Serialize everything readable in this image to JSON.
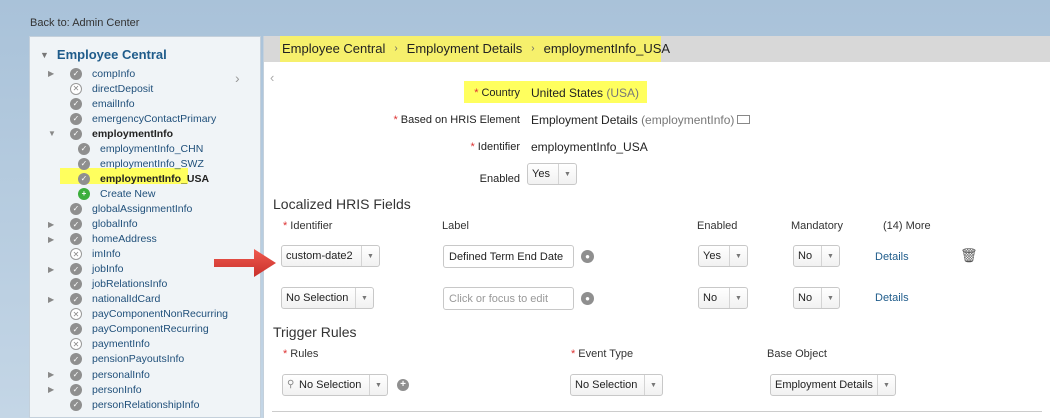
{
  "back_link": "Back to: Admin Center",
  "tree": {
    "root": "Employee Central",
    "items": [
      {
        "label": "compInfo",
        "icon": "check",
        "exp": true
      },
      {
        "label": "directDeposit",
        "icon": "x",
        "exp": false
      },
      {
        "label": "emailInfo",
        "icon": "check",
        "exp": false
      },
      {
        "label": "emergencyContactPrimary",
        "icon": "check",
        "exp": false
      },
      {
        "label": "employmentInfo",
        "icon": "check",
        "exp": "open"
      },
      {
        "label": "employmentInfo_CHN",
        "icon": "check",
        "exp": false
      },
      {
        "label": "employmentInfo_SWZ",
        "icon": "check",
        "exp": false
      },
      {
        "label": "employmentInfo_USA",
        "icon": "check",
        "exp": false
      },
      {
        "label": "Create New",
        "icon": "plus",
        "exp": false
      },
      {
        "label": "globalAssignmentInfo",
        "icon": "check",
        "exp": false
      },
      {
        "label": "globalInfo",
        "icon": "check",
        "exp": true
      },
      {
        "label": "homeAddress",
        "icon": "check",
        "exp": true
      },
      {
        "label": "imInfo",
        "icon": "x",
        "exp": false
      },
      {
        "label": "jobInfo",
        "icon": "check",
        "exp": true
      },
      {
        "label": "jobRelationsInfo",
        "icon": "check",
        "exp": false
      },
      {
        "label": "nationalIdCard",
        "icon": "check",
        "exp": true
      },
      {
        "label": "payComponentNonRecurring",
        "icon": "x",
        "exp": false
      },
      {
        "label": "payComponentRecurring",
        "icon": "check",
        "exp": false
      },
      {
        "label": "paymentInfo",
        "icon": "x",
        "exp": false
      },
      {
        "label": "pensionPayoutsInfo",
        "icon": "check",
        "exp": false
      },
      {
        "label": "personalInfo",
        "icon": "check",
        "exp": true
      },
      {
        "label": "personInfo",
        "icon": "check",
        "exp": true
      },
      {
        "label": "personRelationshipInfo",
        "icon": "check",
        "exp": false
      }
    ]
  },
  "breadcrumb": {
    "crumb1": "Employee Central",
    "crumb2": "Employment Details",
    "crumb3": "employmentInfo_USA"
  },
  "form": {
    "country_label": "Country",
    "country_value": "United States",
    "country_code": "(USA)",
    "based_label": "Based on HRIS Element",
    "based_value": "Employment Details",
    "based_code": "(employmentInfo)",
    "identifier_label": "Identifier",
    "identifier_value": "employmentInfo_USA",
    "enabled_label": "Enabled",
    "enabled_value": "Yes"
  },
  "localized": {
    "title": "Localized HRIS Fields",
    "headers": {
      "identifier": "Identifier",
      "label": "Label",
      "enabled": "Enabled",
      "mandatory": "Mandatory",
      "more": "(14) More"
    },
    "rows": [
      {
        "identifier": "custom-date2",
        "label": "Defined Term End Date",
        "enabled": "Yes",
        "mandatory": "No",
        "details": "Details"
      },
      {
        "identifier": "No Selection",
        "label_placeholder": "Click or focus to edit",
        "enabled": "No",
        "mandatory": "No",
        "details": "Details"
      }
    ]
  },
  "trigger": {
    "title": "Trigger Rules",
    "headers": {
      "rules": "Rules",
      "event_type": "Event Type",
      "base_object": "Base Object"
    },
    "rules_value": "No Selection",
    "event_value": "No Selection",
    "base_value": "Employment Details"
  },
  "colors": {
    "highlight": "#ffff5e",
    "link": "#1f5c8b",
    "arrow": "#e8463c"
  }
}
